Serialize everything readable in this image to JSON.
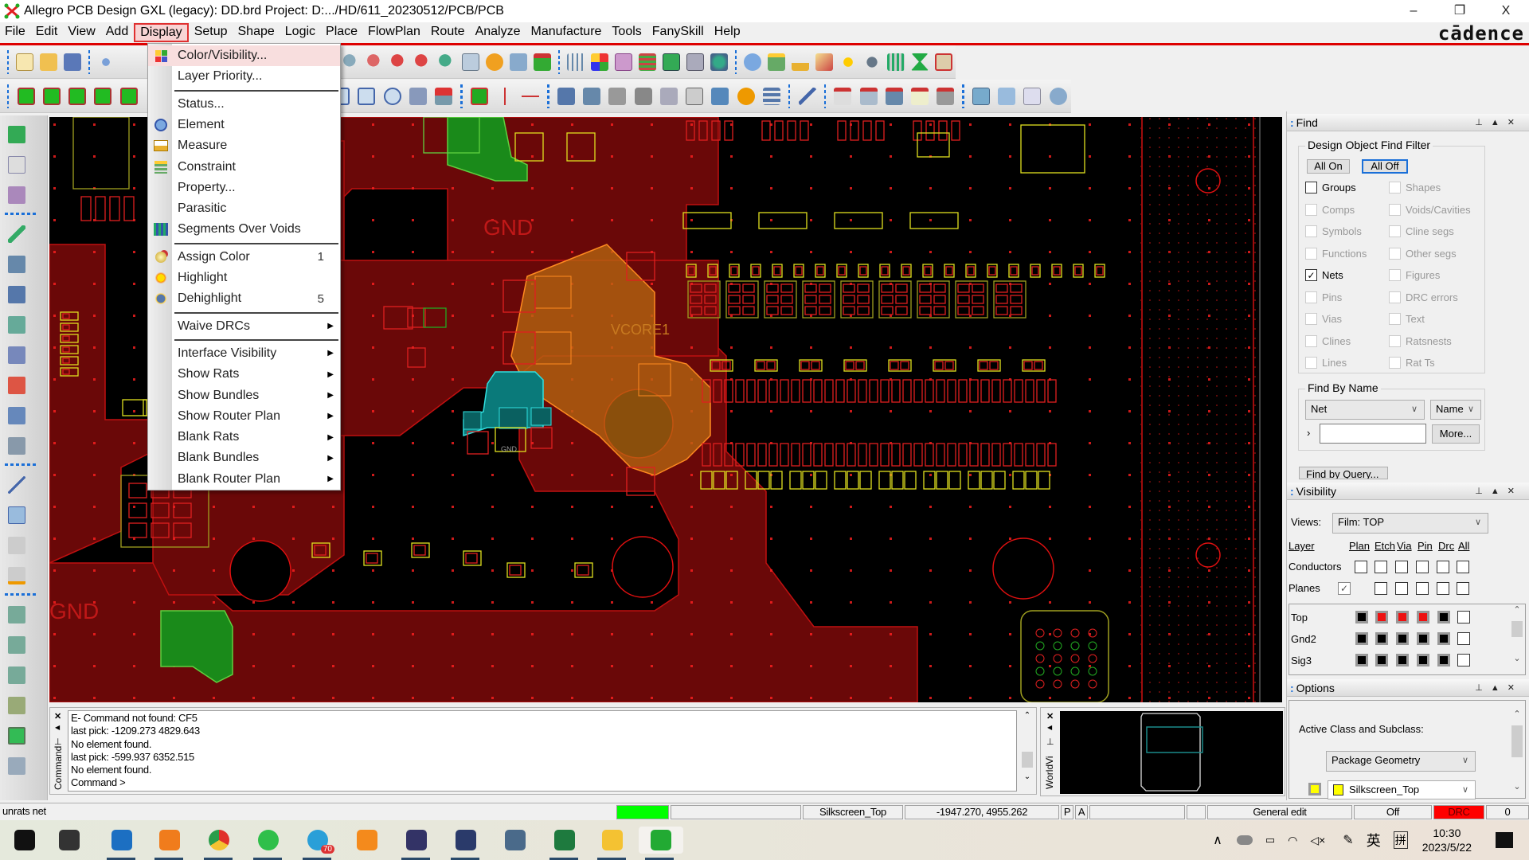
{
  "window": {
    "title": "Allegro PCB Design GXL (legacy): DD.brd  Project: D:.../HD/611_20230512/PCB/PCB",
    "minimize": "–",
    "restore": "❐",
    "close": "X"
  },
  "menubar": {
    "items": [
      {
        "label": "File"
      },
      {
        "label": "Edit"
      },
      {
        "label": "View"
      },
      {
        "label": "Add"
      },
      {
        "label": "Display",
        "active": true
      },
      {
        "label": "Setup"
      },
      {
        "label": "Shape"
      },
      {
        "label": "Logic"
      },
      {
        "label": "Place"
      },
      {
        "label": "FlowPlan"
      },
      {
        "label": "Route"
      },
      {
        "label": "Analyze"
      },
      {
        "label": "Manufacture"
      },
      {
        "label": "Tools"
      },
      {
        "label": "FanySkill"
      },
      {
        "label": "Help"
      }
    ],
    "brand_logo": "cādence"
  },
  "display_menu": {
    "items": [
      {
        "label": "Color/Visibility...",
        "icon": "color-visibility-icon",
        "highlighted": true
      },
      {
        "label": "Layer Priority..."
      },
      {
        "separator": true
      },
      {
        "label": "Status..."
      },
      {
        "label": "Element",
        "icon": "element-info-icon"
      },
      {
        "label": "Measure",
        "icon": "measure-ruler-icon"
      },
      {
        "label": "Constraint",
        "icon": "constraint-icon"
      },
      {
        "label": "Property..."
      },
      {
        "label": "Parasitic"
      },
      {
        "label": "Segments Over Voids",
        "icon": "segments-over-voids-icon"
      },
      {
        "separator": true
      },
      {
        "label": "Assign Color",
        "icon": "assign-color-icon",
        "accelerator": "1"
      },
      {
        "label": "Highlight",
        "icon": "highlight-sun-icon"
      },
      {
        "label": "Dehighlight",
        "icon": "dehighlight-icon",
        "accelerator": "5"
      },
      {
        "separator": true
      },
      {
        "label": "Waive DRCs",
        "submenu": true
      },
      {
        "separator": true
      },
      {
        "label": "Interface Visibility",
        "submenu": true
      },
      {
        "label": "Show Rats",
        "submenu": true
      },
      {
        "label": "Show Bundles",
        "submenu": true
      },
      {
        "label": "Show Router Plan",
        "submenu": true
      },
      {
        "label": "Blank Rats",
        "submenu": true
      },
      {
        "label": "Blank Bundles",
        "submenu": true
      },
      {
        "label": "Blank Router Plan",
        "submenu": true
      }
    ]
  },
  "canvas": {
    "net_labels": [
      "GND",
      "GND",
      "VCORE1",
      "GND"
    ]
  },
  "find_panel": {
    "title": "Find",
    "filter_legend": "Design Object Find Filter",
    "all_on": "All On",
    "all_off": "All Off",
    "left_items": [
      {
        "label": "Groups",
        "checked": false,
        "enabled": true
      },
      {
        "label": "Comps",
        "checked": false,
        "enabled": false
      },
      {
        "label": "Symbols",
        "checked": false,
        "enabled": false
      },
      {
        "label": "Functions",
        "checked": false,
        "enabled": false
      },
      {
        "label": "Nets",
        "checked": true,
        "enabled": true
      },
      {
        "label": "Pins",
        "checked": false,
        "enabled": false
      },
      {
        "label": "Vias",
        "checked": false,
        "enabled": false
      },
      {
        "label": "Clines",
        "checked": false,
        "enabled": false
      },
      {
        "label": "Lines",
        "checked": false,
        "enabled": false
      }
    ],
    "right_items": [
      {
        "label": "Shapes",
        "checked": false,
        "enabled": false
      },
      {
        "label": "Voids/Cavities",
        "checked": false,
        "enabled": false
      },
      {
        "label": "Cline segs",
        "checked": false,
        "enabled": false
      },
      {
        "label": "Other segs",
        "checked": false,
        "enabled": false
      },
      {
        "label": "Figures",
        "checked": false,
        "enabled": false
      },
      {
        "label": "DRC errors",
        "checked": false,
        "enabled": false
      },
      {
        "label": "Text",
        "checked": false,
        "enabled": false
      },
      {
        "label": "Ratsnests",
        "checked": false,
        "enabled": false
      },
      {
        "label": "Rat Ts",
        "checked": false,
        "enabled": false
      }
    ],
    "find_by_name_legend": "Find By Name",
    "type_select": "Net",
    "mode_select": "Name",
    "name_input_value": "",
    "more_button": "More...",
    "find_by_query": "Find by Query..."
  },
  "visibility_panel": {
    "title": "Visibility",
    "views_label": "Views:",
    "views_value": "Film: TOP",
    "columns": [
      "Layer",
      "Plan",
      "Etch",
      "Via",
      "Pin",
      "Drc",
      "All"
    ],
    "group_rows": [
      {
        "label": "Conductors",
        "plan": null,
        "values": [
          false,
          false,
          false,
          false,
          false,
          false
        ]
      },
      {
        "label": "Planes",
        "plan": true,
        "values": [
          false,
          false,
          false,
          false,
          false
        ]
      }
    ],
    "layers": [
      {
        "name": "Top",
        "colors": [
          "#000000",
          "#ee1111",
          "#ee1111",
          "#ee1111",
          "#000000"
        ],
        "all": false
      },
      {
        "name": "Gnd2",
        "colors": [
          "#000000",
          "#000000",
          "#000000",
          "#000000",
          "#000000"
        ],
        "all": false
      },
      {
        "name": "Sig3",
        "colors": [
          "#000000",
          "#000000",
          "#000000",
          "#000000",
          "#000000"
        ],
        "all": false
      }
    ]
  },
  "options_panel": {
    "title": "Options",
    "active_label": "Active Class and Subclass:",
    "class_value": "Package Geometry",
    "subclass_value": "Silkscreen_Top",
    "subclass_color": "#ffff00"
  },
  "command_window": {
    "side_label": "Command",
    "lines": [
      "E- Command not found: CF5",
      "last pick:  -1209.273 4829.643",
      "No element found.",
      "last pick:  -599.937 6352.515",
      "No element found.",
      "Command >"
    ]
  },
  "worldview": {
    "side_label": "WorldVi"
  },
  "statusbar": {
    "message": "unrats net",
    "indicator_color": "#00ff00",
    "active_subclass": "Silkscreen_Top",
    "coordinates": "-1947.270, 4955.262",
    "p_toggle": "P",
    "a_toggle": "A",
    "mode": "General edit",
    "off_label": "Off",
    "drc_label": "DRC",
    "drc_count": "0"
  },
  "taskbar": {
    "apps": [
      {
        "name": "windows-start-icon",
        "color": "#111111"
      },
      {
        "name": "task-view-icon",
        "color": "#333333"
      },
      {
        "name": "outlook-icon",
        "color": "#1c6fc2",
        "running": true
      },
      {
        "name": "search-app-icon",
        "color": "#f07c1c",
        "running": true
      },
      {
        "name": "chrome-icon",
        "color": "#e0302a",
        "running": true
      },
      {
        "name": "wechat-icon",
        "color": "#2fbf4a",
        "running": true
      },
      {
        "name": "telegram-icon",
        "color": "#2a9fd8",
        "running": true,
        "badge": "70"
      },
      {
        "name": "pdf-reader-icon",
        "color": "#f48a1c"
      },
      {
        "name": "pcb-editor-icon",
        "color": "#333366",
        "running": true
      },
      {
        "name": "cat-app-icon",
        "color": "#2a3a6a",
        "running": true
      },
      {
        "name": "calculator-icon",
        "color": "#4a6a8a"
      },
      {
        "name": "excel-icon",
        "color": "#1e7a3e",
        "running": true
      },
      {
        "name": "file-explorer-icon",
        "color": "#f4c232",
        "running": true
      },
      {
        "name": "allegro-icon",
        "color": "#22aa33",
        "running": true,
        "active": true
      }
    ],
    "tray": {
      "ime": "英",
      "ime2": "拼",
      "time": "10:30",
      "date": "2023/5/22"
    }
  }
}
